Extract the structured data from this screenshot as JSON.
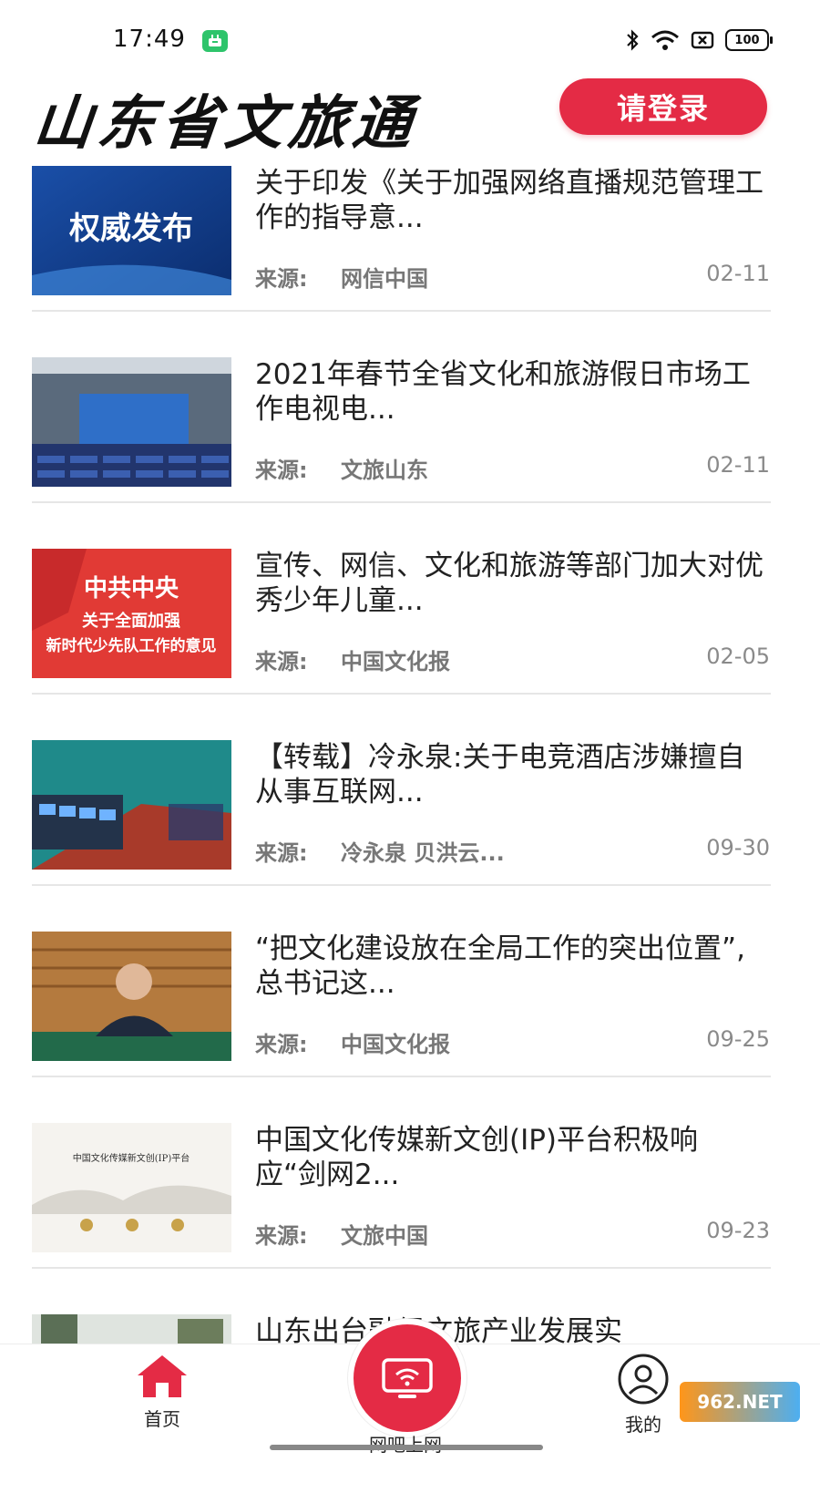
{
  "status_bar": {
    "time": "17:49",
    "battery": "100"
  },
  "header": {
    "title": "山东省文旅通",
    "login_label": "请登录"
  },
  "news": [
    {
      "title": "关于印发《关于加强网络直播规范管理工作的指导意...",
      "source_label": "来源:",
      "source": "网信中国",
      "date": "02-11",
      "thumb_text": "权威发布"
    },
    {
      "title": "2021年春节全省文化和旅游假日市场工作电视电...",
      "source_label": "来源:",
      "source": "文旅山东",
      "date": "02-11"
    },
    {
      "title": "宣传、网信、文化和旅游等部门加大对优秀少年儿童...",
      "source_label": "来源:",
      "source": "中国文化报",
      "date": "02-05",
      "thumb_line1": "中共中央",
      "thumb_line2": "关于全面加强",
      "thumb_line3": "新时代少先队工作的意见"
    },
    {
      "title": "【转载】冷永泉:关于电竞酒店涉嫌擅自从事互联网...",
      "source_label": "来源:",
      "source": "冷永泉 贝洪云...",
      "date": "09-30"
    },
    {
      "title": "“把文化建设放在全局工作的突出位置”,总书记这...",
      "source_label": "来源:",
      "source": "中国文化报",
      "date": "09-25"
    },
    {
      "title": "中国文化传媒新文创(IP)平台积极响应“剑网2...",
      "source_label": "来源:",
      "source": "文旅中国",
      "date": "09-23",
      "thumb_text": "中国文化传媒新文创(IP)平台"
    },
    {
      "title": "山东出台融促文旅产业发展实"
    }
  ],
  "nav": {
    "home": "首页",
    "center": "网吧上网",
    "mine": "我的"
  },
  "watermark": "962.NET",
  "colors": {
    "accent": "#e42b45"
  }
}
